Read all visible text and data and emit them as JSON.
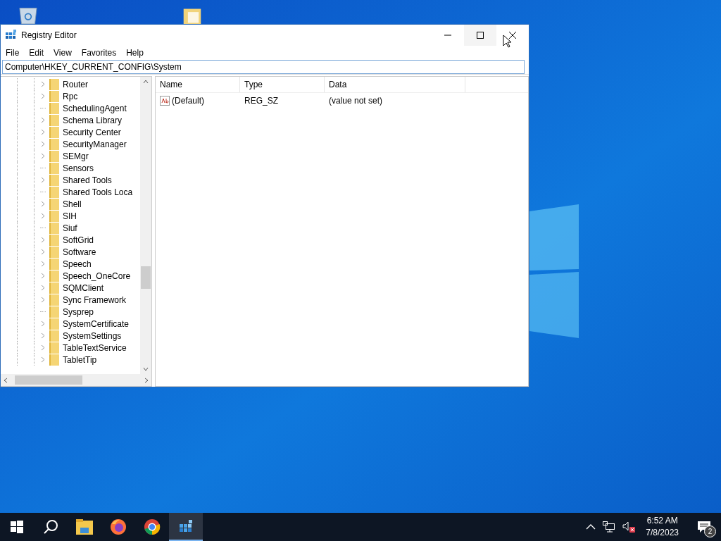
{
  "window": {
    "title": "Registry Editor"
  },
  "menu": [
    "File",
    "Edit",
    "View",
    "Favorites",
    "Help"
  ],
  "address": "Computer\\HKEY_CURRENT_CONFIG\\System",
  "tree": [
    {
      "label": "Router",
      "expandable": true
    },
    {
      "label": "Rpc",
      "expandable": true
    },
    {
      "label": "SchedulingAgent",
      "expandable": false
    },
    {
      "label": "Schema Library",
      "expandable": true
    },
    {
      "label": "Security Center",
      "expandable": true
    },
    {
      "label": "SecurityManager",
      "expandable": true
    },
    {
      "label": "SEMgr",
      "expandable": true
    },
    {
      "label": "Sensors",
      "expandable": false
    },
    {
      "label": "Shared Tools",
      "expandable": true
    },
    {
      "label": "Shared Tools Loca",
      "expandable": false
    },
    {
      "label": "Shell",
      "expandable": true
    },
    {
      "label": "SIH",
      "expandable": true
    },
    {
      "label": "Siuf",
      "expandable": false
    },
    {
      "label": "SoftGrid",
      "expandable": true
    },
    {
      "label": "Software",
      "expandable": true
    },
    {
      "label": "Speech",
      "expandable": true
    },
    {
      "label": "Speech_OneCore",
      "expandable": true
    },
    {
      "label": "SQMClient",
      "expandable": true
    },
    {
      "label": "Sync Framework",
      "expandable": true
    },
    {
      "label": "Sysprep",
      "expandable": false
    },
    {
      "label": "SystemCertificate",
      "expandable": true
    },
    {
      "label": "SystemSettings",
      "expandable": true
    },
    {
      "label": "TableTextService",
      "expandable": true
    },
    {
      "label": "TabletTip",
      "expandable": true
    }
  ],
  "columns": [
    "Name",
    "Type",
    "Data"
  ],
  "values": [
    {
      "name": "(Default)",
      "type": "REG_SZ",
      "data": "(value not set)"
    }
  ],
  "taskbar": {
    "apps": [
      {
        "kind": "explorer",
        "selected": false
      },
      {
        "kind": "firefox",
        "selected": false
      },
      {
        "kind": "chrome",
        "selected": false
      },
      {
        "kind": "regedit",
        "selected": true
      }
    ]
  },
  "tray": {
    "time": "6:52 AM",
    "date": "7/8/2023",
    "notifications": "2"
  }
}
